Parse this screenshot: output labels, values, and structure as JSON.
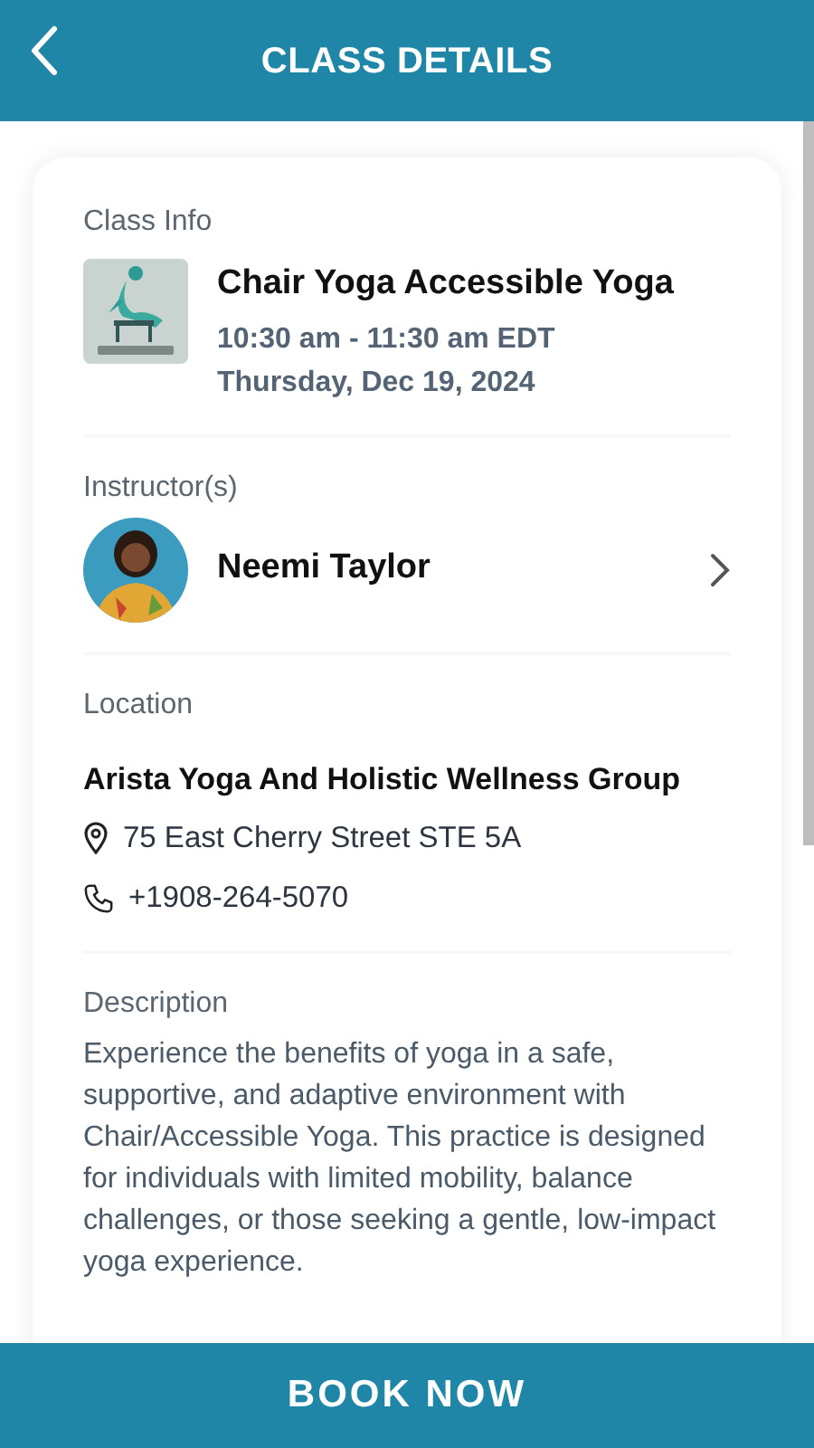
{
  "header": {
    "title": "CLASS DETAILS"
  },
  "class_info": {
    "label": "Class Info",
    "name": "Chair Yoga Accessible Yoga",
    "time": "10:30 am - 11:30 am EDT",
    "date": "Thursday, Dec 19, 2024"
  },
  "instructors": {
    "label": "Instructor(s)",
    "items": [
      {
        "name": "Neemi Taylor"
      }
    ]
  },
  "location": {
    "label": "Location",
    "name": "Arista Yoga And Holistic Wellness Group",
    "address": "75 East Cherry Street STE 5A",
    "phone": "+1908-264-5070"
  },
  "description": {
    "label": "Description",
    "text": "Experience the benefits of yoga in a safe, supportive, and adaptive environment with Chair/Accessible Yoga. This practice is designed for individuals with limited mobility, balance challenges, or those seeking a gentle, low-impact yoga experience."
  },
  "book_button": "BOOK NOW"
}
